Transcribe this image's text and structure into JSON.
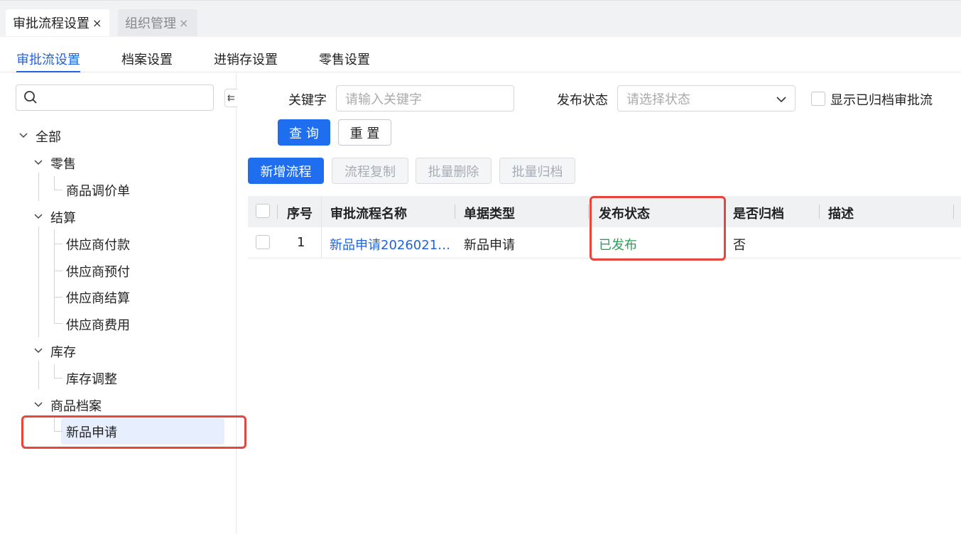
{
  "page_tabs": [
    {
      "label": "审批流程设置",
      "close": "×",
      "active": true
    },
    {
      "label": "组织管理",
      "close": "×",
      "active": false
    }
  ],
  "sub_tabs": [
    {
      "label": "审批流设置",
      "active": true
    },
    {
      "label": "档案设置",
      "active": false
    },
    {
      "label": "进销存设置",
      "active": false
    },
    {
      "label": "零售设置",
      "active": false
    }
  ],
  "sidebar": {
    "search_placeholder": "",
    "collapse_icon": "collapse-left-icon",
    "tree": {
      "root": "全部",
      "groups": [
        {
          "label": "零售",
          "children": [
            "商品调价单"
          ]
        },
        {
          "label": "结算",
          "children": [
            "供应商付款",
            "供应商预付",
            "供应商结算",
            "供应商费用"
          ]
        },
        {
          "label": "库存",
          "children": [
            "库存调整"
          ]
        },
        {
          "label": "商品档案",
          "children": [
            "新品申请"
          ]
        }
      ],
      "selected": "新品申请"
    }
  },
  "filters": {
    "keyword_label": "关键字",
    "keyword_placeholder": "请输入关键字",
    "status_label": "发布状态",
    "status_placeholder": "请选择状态",
    "show_archived_label": "显示已归档审批流",
    "query_button": "查 询",
    "reset_button": "重 置"
  },
  "toolbar": {
    "add": "新增流程",
    "copy": "流程复制",
    "batch_delete": "批量删除",
    "batch_archive": "批量归档"
  },
  "table": {
    "columns": [
      "序号",
      "审批流程名称",
      "单据类型",
      "发布状态",
      "是否归档",
      "描述"
    ],
    "rows": [
      {
        "index": "1",
        "name": "新品申请2026021…",
        "doc_type": "新品申请",
        "status": "已发布",
        "archived": "否",
        "desc": ""
      }
    ]
  },
  "colors": {
    "accent": "#1f6ef0",
    "published": "#2e9e5b",
    "highlight": "#e8453c",
    "link": "#1f63e0"
  }
}
